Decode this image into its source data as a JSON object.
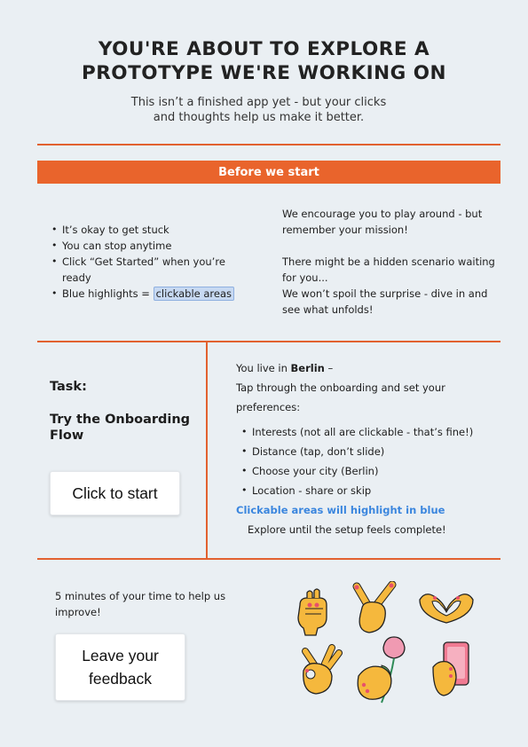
{
  "header": {
    "title_line1": "YOU'RE ABOUT TO EXPLORE A",
    "title_line2": "PROTOTYPE WE'RE WORKING ON",
    "subtitle_line1": "This isn’t a finished app yet - but your clicks",
    "subtitle_line2": "and thoughts help us make it better."
  },
  "before": {
    "banner": "Before we start",
    "bullets": [
      "It’s okay to get stuck",
      "You can stop anytime",
      "Click “Get Started” when you’re ready"
    ],
    "highlight_prefix": "Blue highlights = ",
    "highlight_label": "clickable areas",
    "right_p1": "We encourage you to play around - but remember your mission!",
    "right_p2": "There might be a hidden scenario waiting for you...",
    "right_p3": "We won’t spoil the surprise - dive in and see what unfolds!"
  },
  "task": {
    "label": "Task:",
    "title": "Try the Onboarding Flow",
    "start_button": "Click to start",
    "intro_prefix": "You live in ",
    "intro_city": "Berlin",
    "intro_suffix": " –",
    "intro_line2": "Tap through the onboarding and set your preferences:",
    "steps": [
      "Interests (not all are clickable - that’s fine!)",
      "Distance (tap, don’t slide)",
      "Choose your city (Berlin)",
      "Location - share or skip"
    ],
    "blue_note": "Clickable areas will highlight in blue",
    "explore": "Explore until the setup feels complete!"
  },
  "feedback": {
    "text": "5 minutes of your time to help us improve!",
    "button_line1": "Leave your",
    "button_line2": "feedback"
  },
  "colors": {
    "accent": "#e9642c",
    "background": "#eaeff3",
    "highlight": "#c7d9f2",
    "link_blue": "#3b86de",
    "hand_fill": "#f5b83d"
  },
  "icons": [
    "fist-hand-icon",
    "peace-hand-icon",
    "heart-hands-icon",
    "ok-hand-icon",
    "tulip-hand-icon",
    "phone-hand-icon"
  ]
}
